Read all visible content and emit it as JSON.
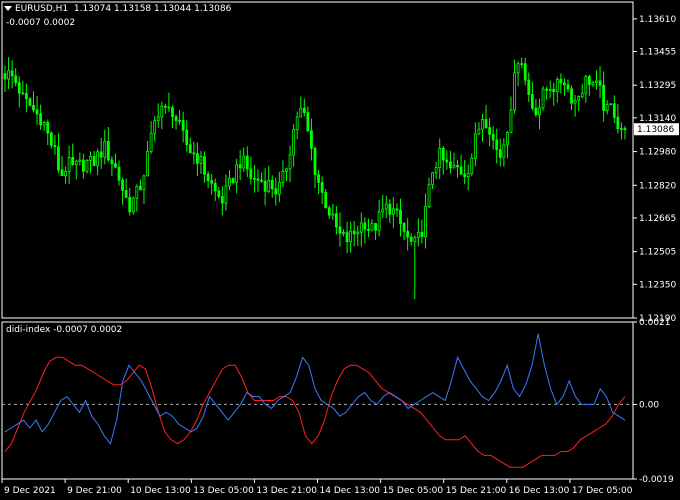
{
  "header": {
    "symbol": "EURUSD,H1",
    "ohlc": "1.13074 1.13158 1.13044 1.13086",
    "indicator_values": "-0.0007  0.0002"
  },
  "indicator": {
    "title": "didi-index -0.0007 0.0002"
  },
  "colors": {
    "background": "#000000",
    "candles": "#00ff00",
    "frame": "#ffffff",
    "line_a": "#ff2020",
    "line_b": "#3a7bff",
    "zero_line": "#aaaaaa"
  },
  "price_axis": {
    "ticks": [
      "1.13610",
      "1.13455",
      "1.13295",
      "1.13140",
      "1.12980",
      "1.12820",
      "1.12665",
      "1.12505",
      "1.12350",
      "1.12190"
    ],
    "current_price": "1.13086"
  },
  "indicator_axis": {
    "ticks": [
      "0.0021",
      "0.00",
      "-0.0019"
    ]
  },
  "time_axis": {
    "ticks": [
      "9 Dec 2021",
      "9 Dec 21:00",
      "10 Dec 13:00",
      "13 Dec 05:00",
      "13 Dec 21:00",
      "14 Dec 13:00",
      "15 Dec 05:00",
      "15 Dec 21:00",
      "16 Dec 13:00",
      "17 Dec 05:00"
    ]
  },
  "chart_data": [
    {
      "type": "candlestick",
      "title": "EURUSD,H1",
      "ylim": [
        1.1219,
        1.1369
      ],
      "close_path": [
        1.1335,
        1.1334,
        1.133,
        1.1322,
        1.132,
        1.1316,
        1.1314,
        1.1305,
        1.1298,
        1.1286,
        1.1292,
        1.129,
        1.1291,
        1.1293,
        1.1292,
        1.1296,
        1.13,
        1.1295,
        1.1289,
        1.128,
        1.1272,
        1.1276,
        1.1283,
        1.1296,
        1.131,
        1.1321,
        1.1316,
        1.1318,
        1.131,
        1.1303,
        1.1298,
        1.1296,
        1.129,
        1.1284,
        1.1278,
        1.1275,
        1.128,
        1.1288,
        1.1294,
        1.129,
        1.1284,
        1.1285,
        1.1283,
        1.1282,
        1.1279,
        1.1286,
        1.13,
        1.1315,
        1.1318,
        1.1305,
        1.129,
        1.1279,
        1.1272,
        1.1264,
        1.1258,
        1.1256,
        1.1258,
        1.1262,
        1.1265,
        1.126,
        1.1264,
        1.127,
        1.1272,
        1.1268,
        1.1262,
        1.1256,
        1.1253,
        1.1258,
        1.1272,
        1.129,
        1.1296,
        1.1292,
        1.1289,
        1.129,
        1.1288,
        1.1292,
        1.1305,
        1.1315,
        1.1312,
        1.13,
        1.1296,
        1.131,
        1.1328,
        1.1348,
        1.133,
        1.132,
        1.1318,
        1.1326,
        1.133,
        1.1328,
        1.1334,
        1.1326,
        1.1322,
        1.1328,
        1.1333,
        1.133,
        1.1326,
        1.1316,
        1.132,
        1.131,
        1.1309
      ],
      "last": {
        "open": 1.13074,
        "high": 1.13158,
        "low": 1.13044,
        "close": 1.13086
      }
    },
    {
      "type": "line",
      "title": "didi-index",
      "ylim": [
        -0.0019,
        0.0021
      ],
      "series": [
        {
          "name": "",
          "values": [
            -0.0012,
            -0.001,
            -0.0006,
            -0.0002,
            0.0001,
            0.0004,
            0.0008,
            0.0011,
            0.0012,
            0.0012,
            0.0011,
            0.001,
            0.001,
            0.0009,
            0.0008,
            0.0007,
            0.0006,
            0.0005,
            0.0005,
            0.0006,
            0.0008,
            0.001,
            0.0009,
            0.0004,
            -0.0002,
            -0.0007,
            -0.0009,
            -0.001,
            -0.0009,
            -0.0007,
            -0.0004,
            0.0,
            0.0003,
            0.0006,
            0.0009,
            0.001,
            0.001,
            0.0007,
            0.0003,
            0.0001,
            0.0001,
            0.0001,
            0.0001,
            0.0002,
            0.0002,
            0.0001,
            -0.0002,
            -0.0008,
            -0.001,
            -0.0008,
            -0.0004,
            0.0002,
            0.0006,
            0.0009,
            0.001,
            0.001,
            0.0009,
            0.0008,
            0.0006,
            0.0004,
            0.0003,
            0.0002,
            0.0001,
            0.0,
            -0.0001,
            -0.0002,
            -0.0004,
            -0.0006,
            -0.0008,
            -0.0009,
            -0.0009,
            -0.0009,
            -0.0008,
            -0.001,
            -0.0012,
            -0.0013,
            -0.0013,
            -0.0014,
            -0.0015,
            -0.0016,
            -0.0016,
            -0.0016,
            -0.0015,
            -0.0014,
            -0.0013,
            -0.0013,
            -0.0013,
            -0.0012,
            -0.0012,
            -0.0011,
            -0.0009,
            -0.0008,
            -0.0007,
            -0.0006,
            -0.0005,
            -0.0003,
            0.0,
            0.0002
          ]
        },
        {
          "name": "",
          "values": [
            -0.0007,
            -0.0006,
            -0.0005,
            -0.0004,
            -0.0006,
            -0.0004,
            -0.0007,
            -0.0005,
            -0.0002,
            0.0001,
            0.0002,
            0.0,
            -0.0002,
            0.0001,
            -0.0003,
            -0.0005,
            -0.0008,
            -0.001,
            -0.0004,
            0.0006,
            0.001,
            0.0008,
            0.0006,
            0.0003,
            0.0,
            -0.0003,
            -0.0002,
            -0.0003,
            -0.0005,
            -0.0006,
            -0.0007,
            -0.0006,
            -0.0003,
            0.0002,
            0.0,
            -0.0002,
            -0.0004,
            -0.0002,
            0.0,
            0.0003,
            0.0002,
            0.0002,
            0.0,
            -0.0001,
            0.0001,
            0.0002,
            0.0003,
            0.0007,
            0.0012,
            0.001,
            0.0004,
            0.0001,
            0.0,
            -0.0001,
            -0.0003,
            -0.0002,
            0.0,
            0.0002,
            0.0003,
            0.0001,
            0.0,
            0.0002,
            0.0003,
            0.0002,
            0.0001,
            -0.0001,
            0.0,
            0.0001,
            0.0002,
            0.0003,
            0.0002,
            0.0001,
            0.0006,
            0.0012,
            0.0009,
            0.0006,
            0.0004,
            0.0002,
            0.0001,
            0.0003,
            0.0006,
            0.001,
            0.0004,
            0.0002,
            0.0005,
            0.001,
            0.0018,
            0.001,
            0.0004,
            0.0,
            0.0002,
            0.0006,
            0.0002,
            0.0,
            0.0,
            0.0,
            0.0004,
            0.0002,
            -0.0002,
            -0.0003,
            -0.0004
          ]
        }
      ]
    }
  ]
}
